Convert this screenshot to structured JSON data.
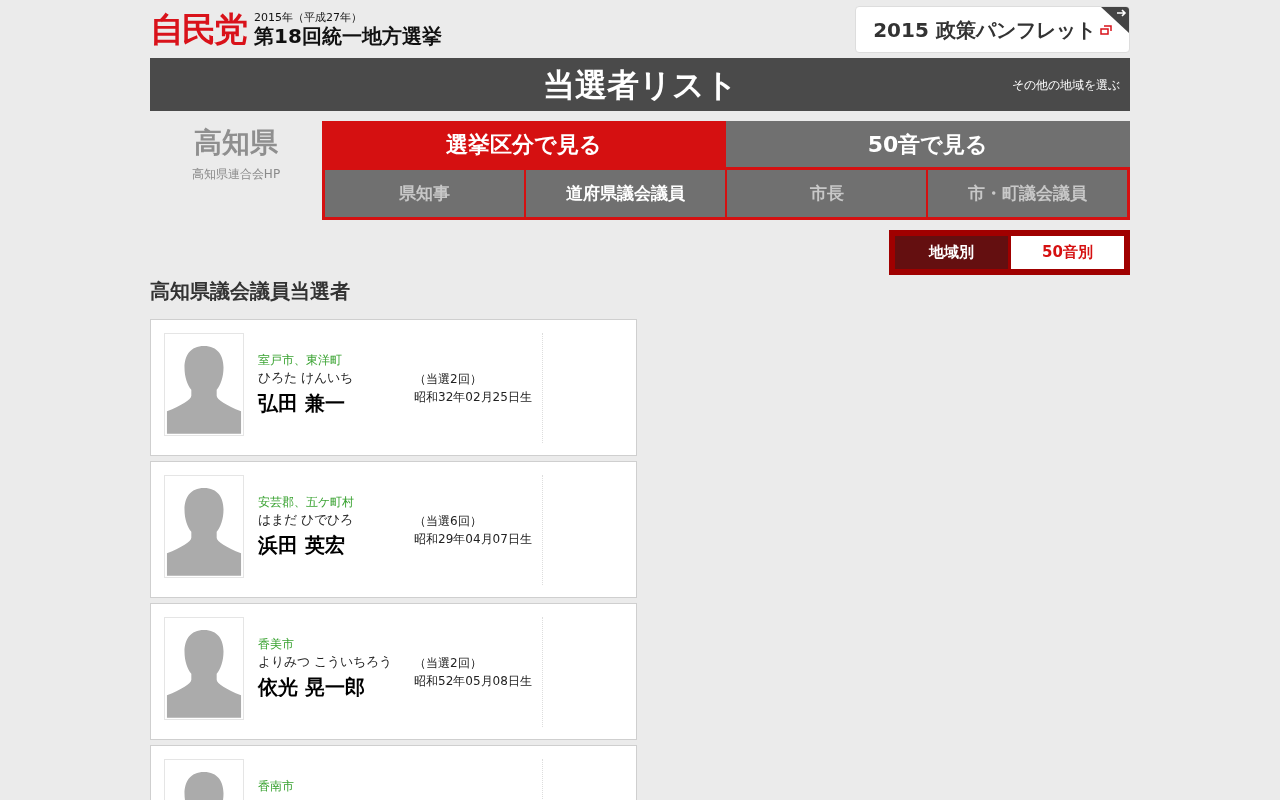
{
  "header": {
    "logo": "自民党",
    "year": "2015年（平成27年）",
    "election": "第18回統一地方選挙",
    "pamphlet": "2015 政策パンフレット"
  },
  "banner": {
    "title": "当選者リスト",
    "link": "その他の地域を選ぶ"
  },
  "prefecture": {
    "name": "高知県",
    "link": "高知県連合会HP"
  },
  "main_tabs": [
    {
      "label": "選挙区分で見る",
      "selected": true
    },
    {
      "label": "50音で見る",
      "selected": false
    }
  ],
  "sub_tabs": [
    {
      "label": "県知事",
      "selected": false
    },
    {
      "label": "道府県議会議員",
      "selected": true
    },
    {
      "label": "市長",
      "selected": false
    },
    {
      "label": "市・町議会議員",
      "selected": false
    }
  ],
  "sort_toggle": [
    {
      "label": "地域別",
      "selected": true
    },
    {
      "label": "50音別",
      "selected": false
    }
  ],
  "heading": "高知県議会議員当選者",
  "candidates": [
    {
      "district": "室戸市、東洋町",
      "reading": "ひろた けんいち",
      "name": "弘田 兼一",
      "terms": "（当選2回）",
      "birth": "昭和32年02月25日生"
    },
    {
      "district": "安芸郡、五ケ町村",
      "reading": "はまだ ひでひろ",
      "name": "浜田 英宏",
      "terms": "（当選6回）",
      "birth": "昭和29年04月07日生"
    },
    {
      "district": "香美市",
      "reading": "よりみつ こういちろう",
      "name": "依光 晃一郎",
      "terms": "（当選2回）",
      "birth": "昭和52年05月08日生"
    },
    {
      "district": "香南市"
    }
  ]
}
